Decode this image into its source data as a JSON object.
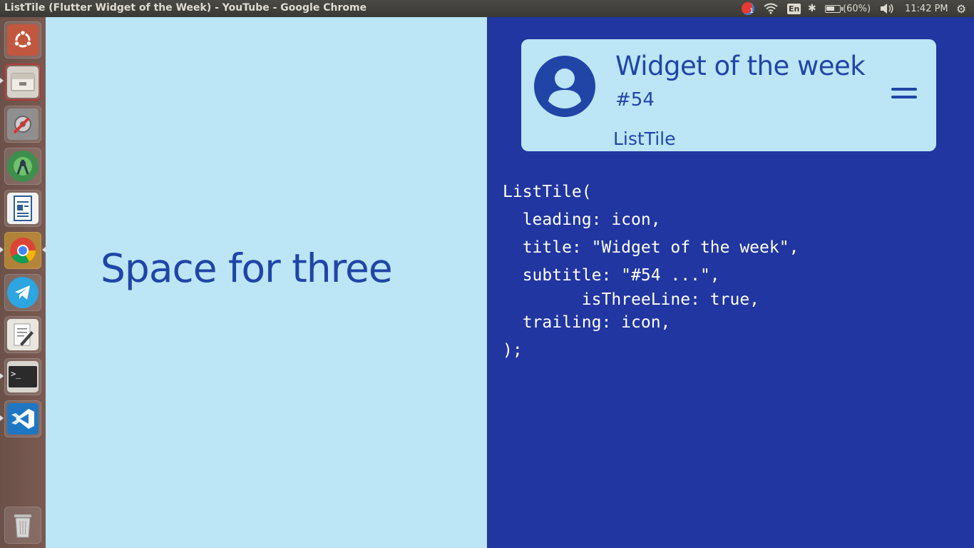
{
  "window": {
    "title": "ListTile (Flutter Widget of the Week) - YouTube - Google Chrome"
  },
  "tray": {
    "notification_count": "1",
    "keyboard_layout": "En",
    "battery": "(60%)",
    "battery_level": 60,
    "clock": "11:42 PM"
  },
  "launcher": {
    "items": [
      {
        "name": "ubuntu-dash-icon"
      },
      {
        "name": "file-manager-icon"
      },
      {
        "name": "system-settings-icon"
      },
      {
        "name": "android-studio-icon"
      },
      {
        "name": "libreoffice-writer-icon"
      },
      {
        "name": "google-chrome-icon"
      },
      {
        "name": "telegram-icon"
      },
      {
        "name": "text-editor-icon"
      },
      {
        "name": "terminal-icon"
      },
      {
        "name": "vscode-icon"
      },
      {
        "name": "trash-icon"
      }
    ]
  },
  "video": {
    "heading": "Space for three",
    "list_tile": {
      "title": "Widget of the week",
      "subtitle": "#54",
      "third_line": "ListTile"
    },
    "code": [
      "ListTile(",
      "  leading: icon,",
      "  title: \"Widget of the week\",",
      "  subtitle: \"#54 ...\",",
      "        isThreeLine: true,",
      "  trailing: icon,",
      ");"
    ]
  },
  "colors": {
    "left_bg": "#bce5f6",
    "right_bg": "#2136a0",
    "accent": "#2145a6"
  }
}
